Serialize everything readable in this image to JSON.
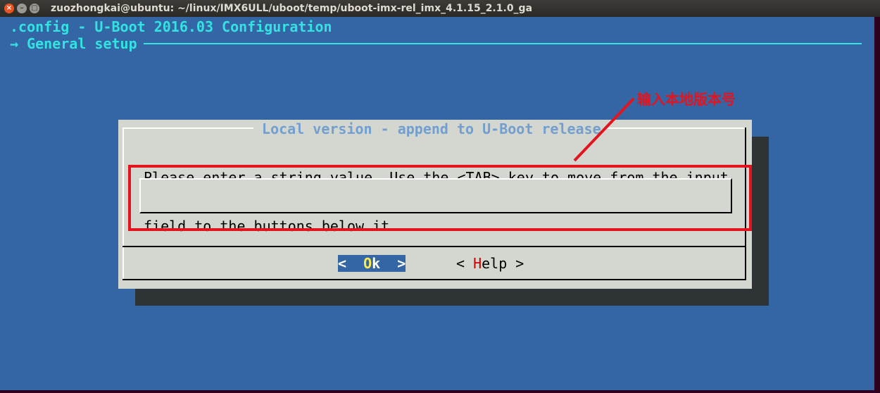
{
  "window": {
    "title": "zuozhongkai@ubuntu: ~/linux/IMX6ULL/uboot/temp/uboot-imx-rel_imx_4.1.15_2.1.0_ga",
    "close_glyph": "×",
    "min_glyph": "–",
    "max_glyph": "□"
  },
  "header": {
    "config_line": ".config - U-Boot 2016.03 Configuration",
    "breadcrumb": "→ General setup"
  },
  "dialog": {
    "title": " Local version - append to U-Boot release ",
    "prompt_line1": "Please enter a string value. Use the <TAB> key to move from the input",
    "prompt_line2": "field to the buttons below it.",
    "input_value": "",
    "ok_left": "<  ",
    "ok_hot": "O",
    "ok_rest": "k  >",
    "help_left": "< ",
    "help_hot": "H",
    "help_rest": "elp >"
  },
  "annotation": {
    "text": "输入本地版本号",
    "color": "#e3141e"
  },
  "colors": {
    "background": "#3465a4",
    "header_text": "#34e2e2",
    "dialog_bg": "#d3d7cf",
    "dialog_title": "#729fcf",
    "hotkey_ok": "#fce94f",
    "hotkey_help": "#cc0000"
  }
}
